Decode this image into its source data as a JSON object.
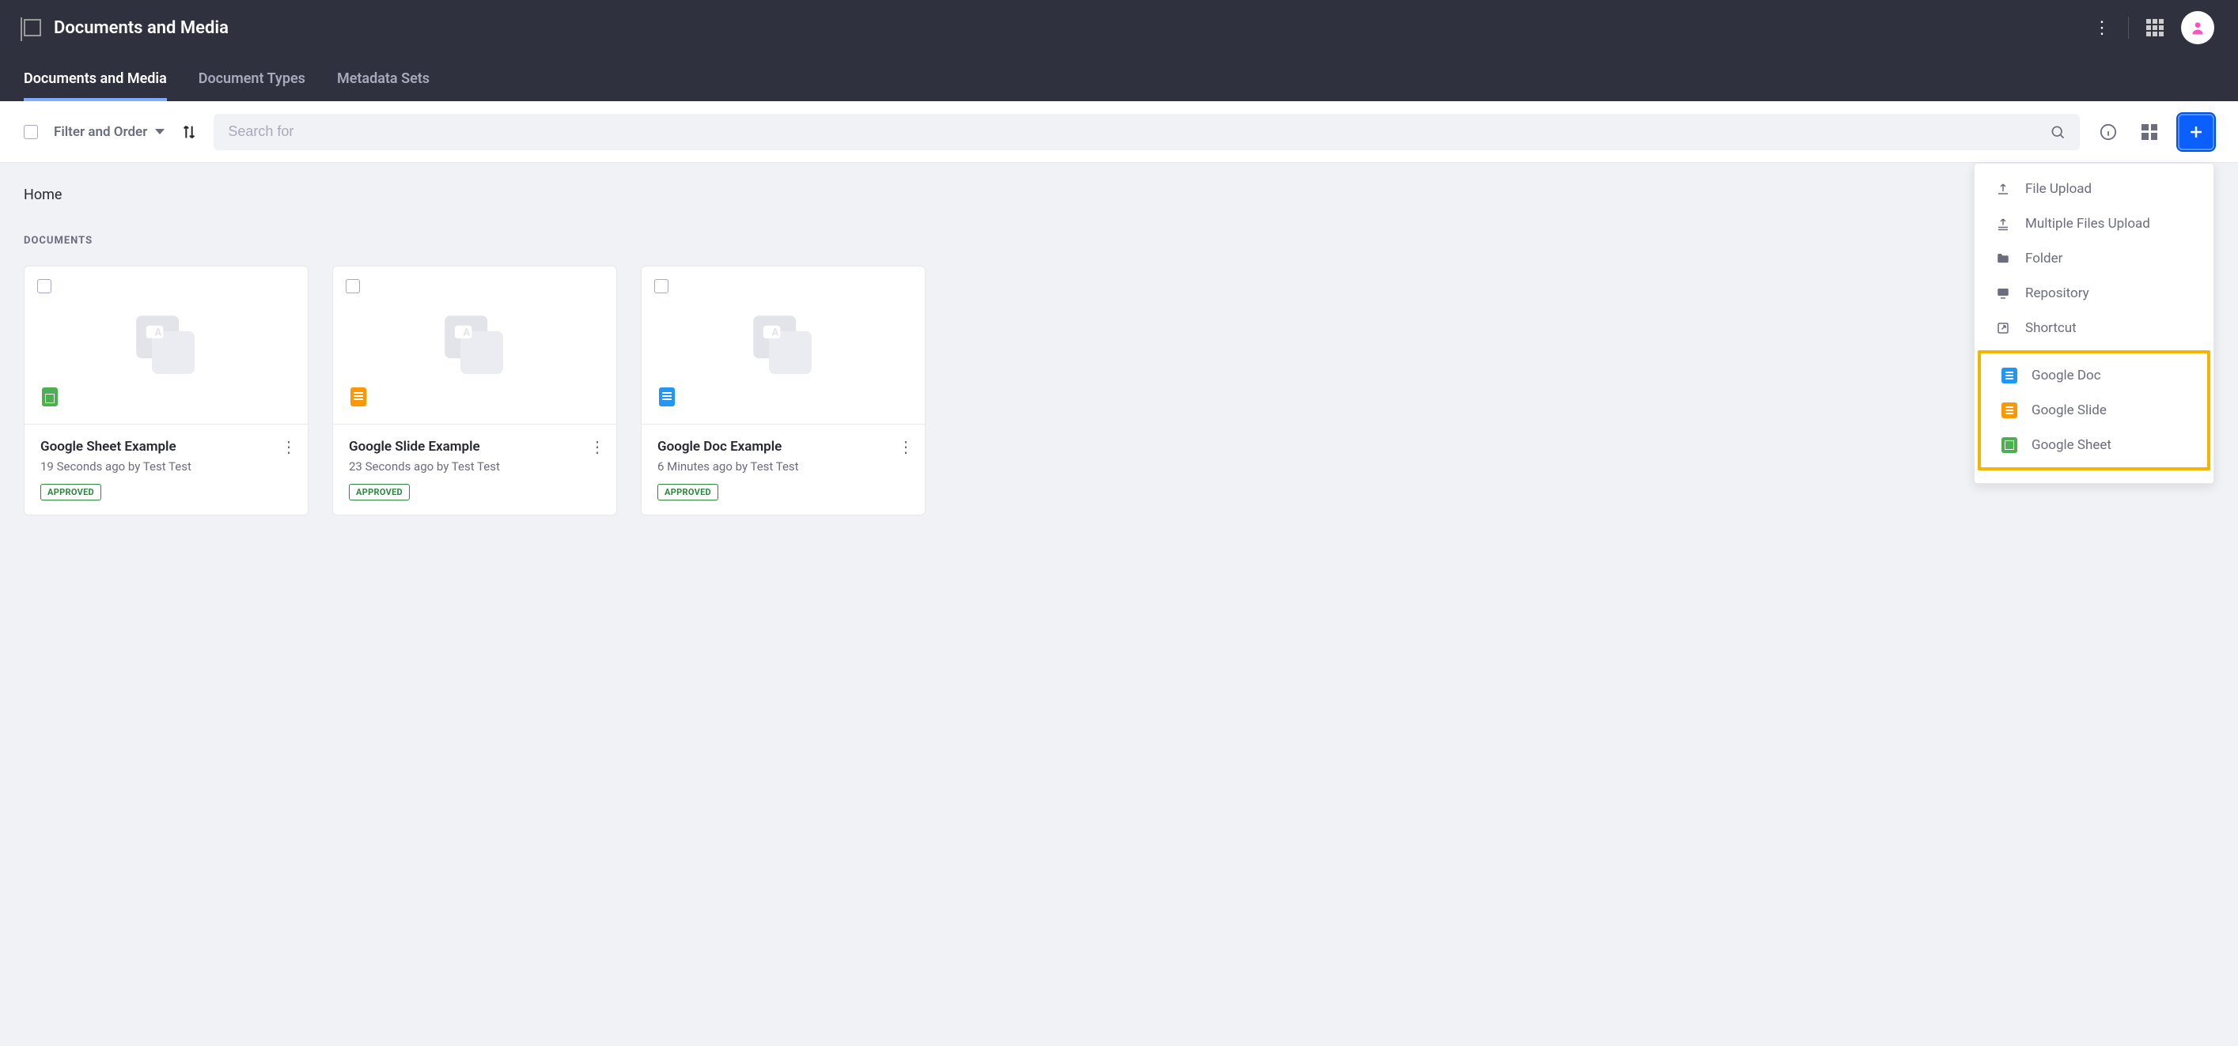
{
  "header": {
    "title": "Documents and Media"
  },
  "tabs": [
    {
      "label": "Documents and Media",
      "active": true
    },
    {
      "label": "Document Types",
      "active": false
    },
    {
      "label": "Metadata Sets",
      "active": false
    }
  ],
  "toolbar": {
    "filter_label": "Filter and Order",
    "search_placeholder": "Search for"
  },
  "breadcrumb": "Home",
  "section_title": "Documents",
  "cards": [
    {
      "title": "Google Sheet Example",
      "sub": "19 Seconds ago by Test Test",
      "badge": "APPROVED",
      "type": "sheet"
    },
    {
      "title": "Google Slide Example",
      "sub": "23 Seconds ago by Test Test",
      "badge": "APPROVED",
      "type": "slide"
    },
    {
      "title": "Google Doc Example",
      "sub": "6 Minutes ago by Test Test",
      "badge": "APPROVED",
      "type": "doc"
    }
  ],
  "add_menu": {
    "items": [
      {
        "label": "File Upload",
        "icon": "upload"
      },
      {
        "label": "Multiple Files Upload",
        "icon": "upload-multi"
      },
      {
        "label": "Folder",
        "icon": "folder"
      },
      {
        "label": "Repository",
        "icon": "repo"
      },
      {
        "label": "Shortcut",
        "icon": "shortcut"
      }
    ],
    "google_items": [
      {
        "label": "Google Doc",
        "icon": "gdoc"
      },
      {
        "label": "Google Slide",
        "icon": "gslide"
      },
      {
        "label": "Google Sheet",
        "icon": "gsheet"
      }
    ]
  }
}
